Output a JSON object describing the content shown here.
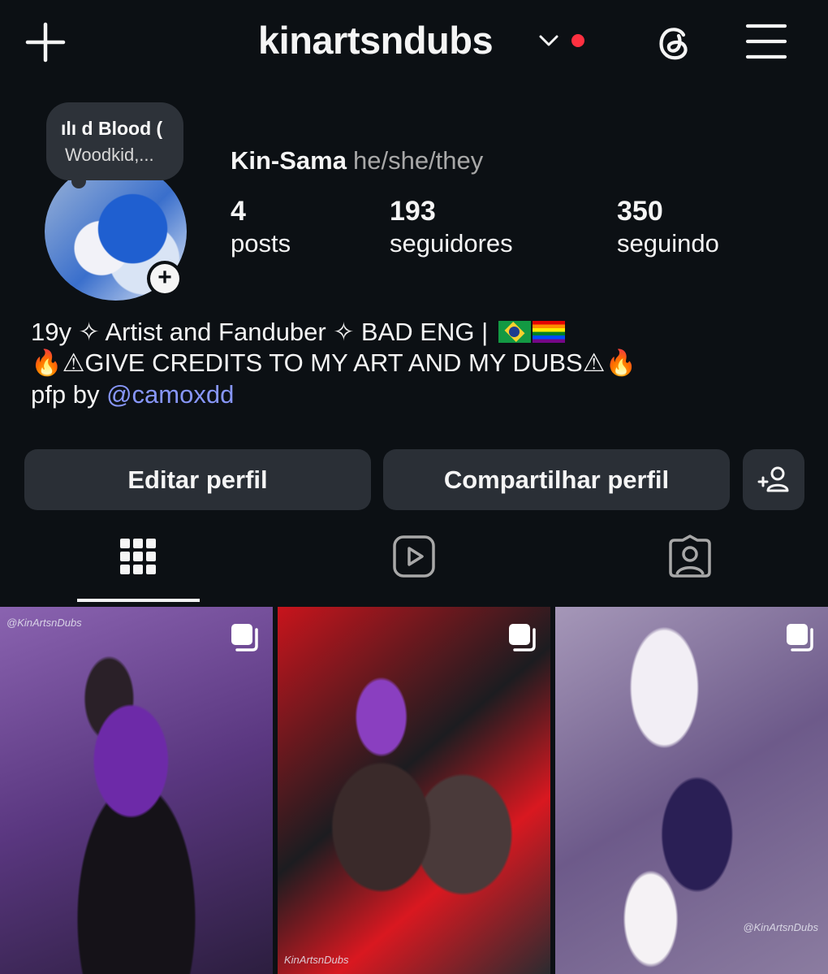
{
  "header": {
    "username": "kinartsndubs",
    "icons": [
      "plus-icon",
      "chevron-down-icon",
      "threads-icon",
      "menu-icon"
    ],
    "notification_dot_color": "#ff3040"
  },
  "note": {
    "line1": "ılı d Blood (",
    "line2": "Woodkid,..."
  },
  "profile": {
    "name": "Kin-Sama",
    "pronouns": "he/she/they"
  },
  "stats": [
    {
      "value": "4",
      "label": "posts"
    },
    {
      "value": "193",
      "label": "seguidores"
    },
    {
      "value": "350",
      "label": "seguindo"
    }
  ],
  "bio": {
    "line1": "19y ✧ Artist and Fanduber ✧ BAD ENG |",
    "line2_text": "⚠GIVE CREDITS TO MY ART AND MY DUBS⚠",
    "fire": "🔥",
    "line3_prefix": "pfp by",
    "line3_link": "@camoxdd",
    "link_color": "#8796f8"
  },
  "buttons": {
    "edit": "Editar perfil",
    "share": "Compartilhar perfil"
  },
  "tabs": [
    "grid-icon",
    "reels-icon",
    "tagged-icon"
  ],
  "posts": [
    {
      "watermark": "@KinArtsnDubs"
    },
    {
      "watermark": "KinArtsnDubs"
    },
    {
      "watermark": "@KinArtsnDubs"
    }
  ]
}
